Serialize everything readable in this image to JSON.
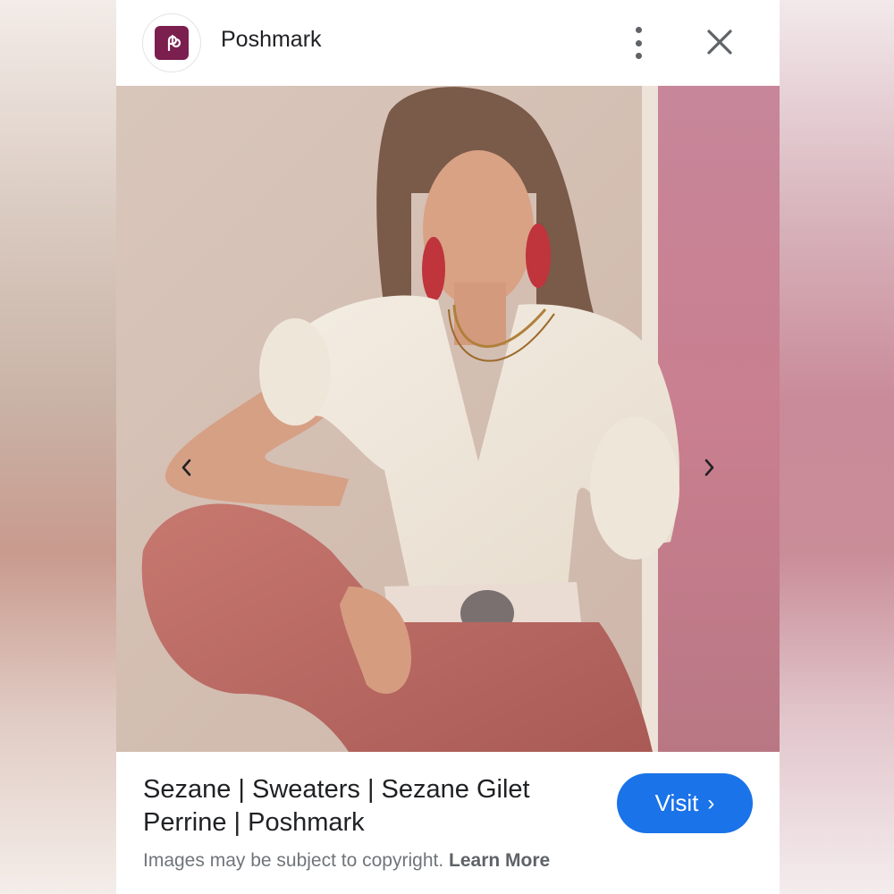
{
  "header": {
    "site_name": "Poshmark",
    "logo_color": "#7b1f4f",
    "more_icon": "more-vert-icon",
    "close_icon": "close-icon"
  },
  "image": {
    "description_icon": "product-photo",
    "prev_icon": "chevron-left-icon",
    "next_icon": "chevron-right-icon"
  },
  "result": {
    "title": "Sezane | Sweaters | Sezane Gilet Perrine | Poshmark",
    "copyright_text": "Images may be subject to copyright.",
    "learn_more": "Learn More",
    "visit_label": "Visit",
    "visit_color": "#1a73e8"
  }
}
